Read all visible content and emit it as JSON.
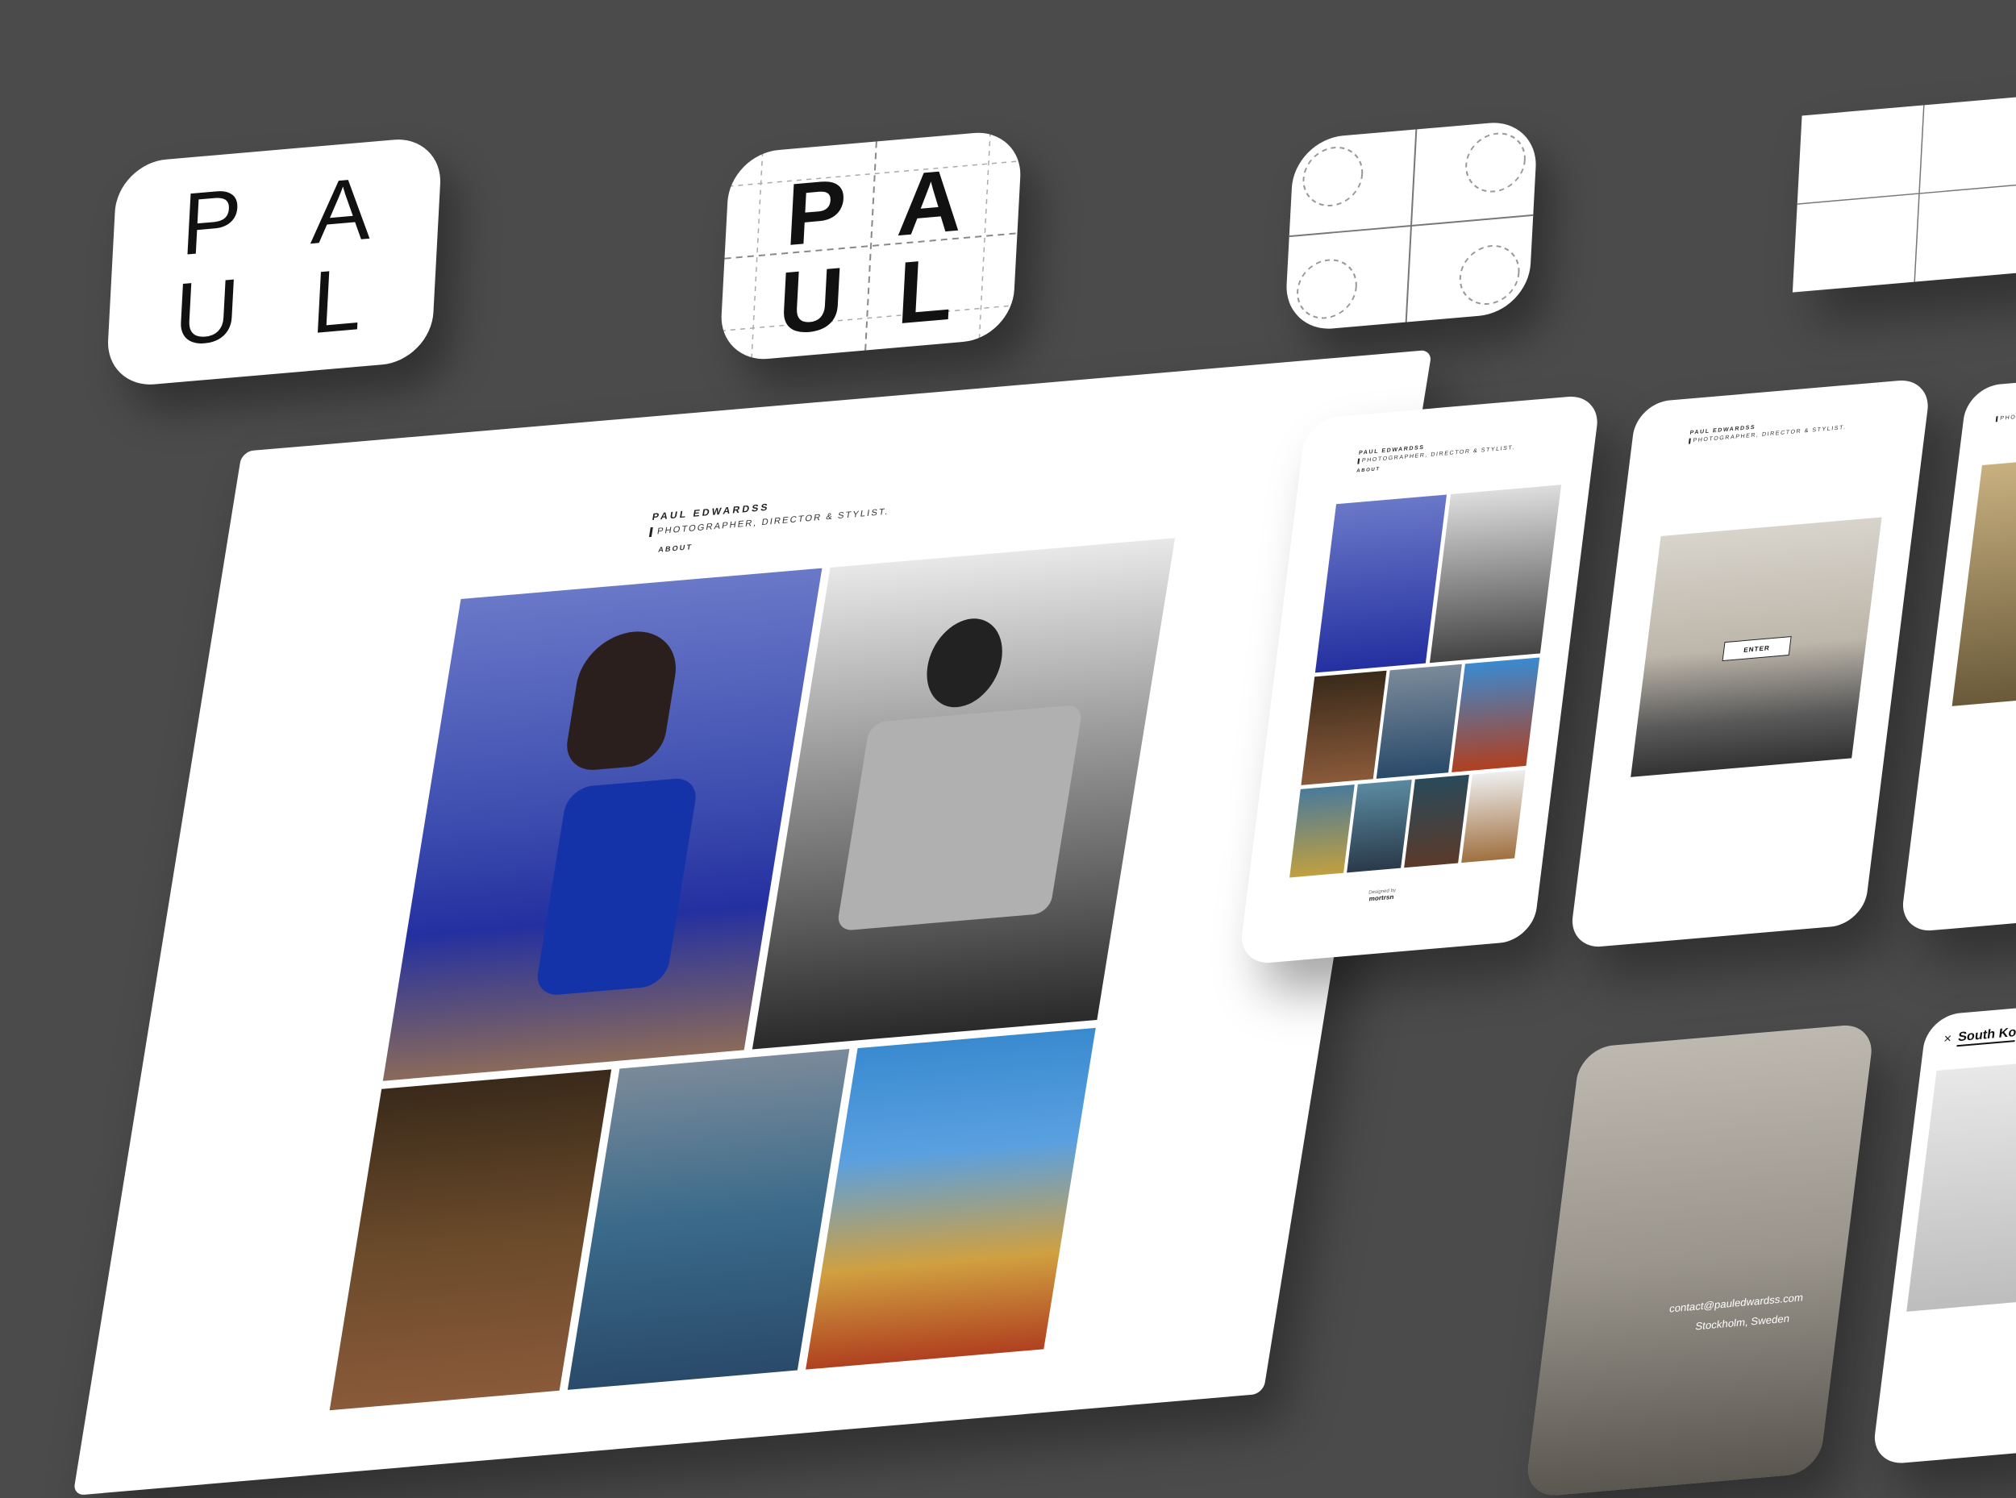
{
  "logo": {
    "letters": [
      "P",
      "A",
      "U",
      "L"
    ]
  },
  "desktop": {
    "name": "PAUL EDWARDSS",
    "subtitle": "PHOTOGRAPHER, DIRECTOR & STYLIST.",
    "nav_about": "ABOUT"
  },
  "mobile1": {
    "name": "PAUL EDWARDSS",
    "subtitle": "PHOTOGRAPHER, DIRECTOR & STYLIST.",
    "nav_about": "ABOUT",
    "footer_small": "Designed by",
    "footer_brand": "mortrsn"
  },
  "mobile2": {
    "name": "PAUL EDWARDSS",
    "subtitle": "PHOTOGRAPHER, DIRECTOR & STYLIST.",
    "enter_label": "ENTER"
  },
  "mobile3": {
    "subtitle_partial": "PHOTO"
  },
  "mobile4": {
    "contact_email": "contact@pauledwardss.com",
    "location": "Stockholm, Sweden"
  },
  "mobile5": {
    "close_glyph": "×",
    "title_partial": "South Ko"
  },
  "colors": {
    "background": "#4b4b4b",
    "card": "#ffffff",
    "text": "#222222"
  }
}
